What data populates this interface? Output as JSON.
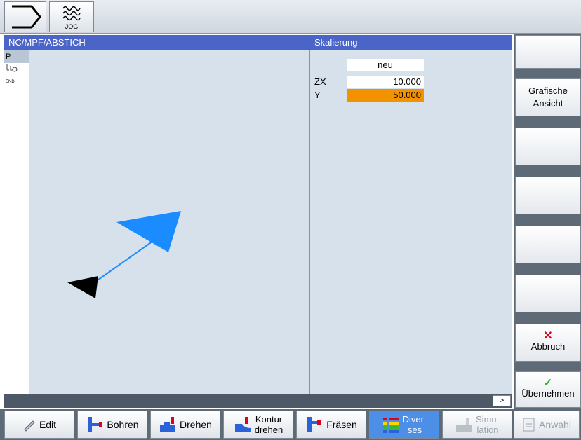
{
  "topbar": {
    "jog_label": "JOG"
  },
  "panel": {
    "left_title": "NC/MPF/ABSTICH",
    "right_title": "Skalierung"
  },
  "strip": {
    "p_label": "P",
    "end_label": "END"
  },
  "params": {
    "column_header": "neu",
    "rows": [
      {
        "label": "ZX",
        "value": "10.000"
      },
      {
        "label": "Y",
        "value": "50.000"
      }
    ]
  },
  "softkeys": {
    "graphic_view_line1": "Grafische",
    "graphic_view_line2": "Ansicht",
    "cancel_label": "Abbruch",
    "accept_label": "Übernehmen"
  },
  "statusbar": {
    "next_label": ">"
  },
  "hbar": {
    "edit": "Edit",
    "bohren": "Bohren",
    "drehen": "Drehen",
    "kontur_line1": "Kontur",
    "kontur_line2": "drehen",
    "fraesen": "Fräsen",
    "divers_line1": "Diver-",
    "divers_line2": "ses",
    "simu_line1": "Simu-",
    "simu_line2": "lation",
    "anwahl": "Anwahl"
  },
  "colors": {
    "header_blue": "#4a64c8",
    "panel_bg": "#d7e1ec",
    "highlight_orange": "#f39200",
    "arrow_blue": "#1a8cff",
    "active_key": "#4d8ee6"
  }
}
